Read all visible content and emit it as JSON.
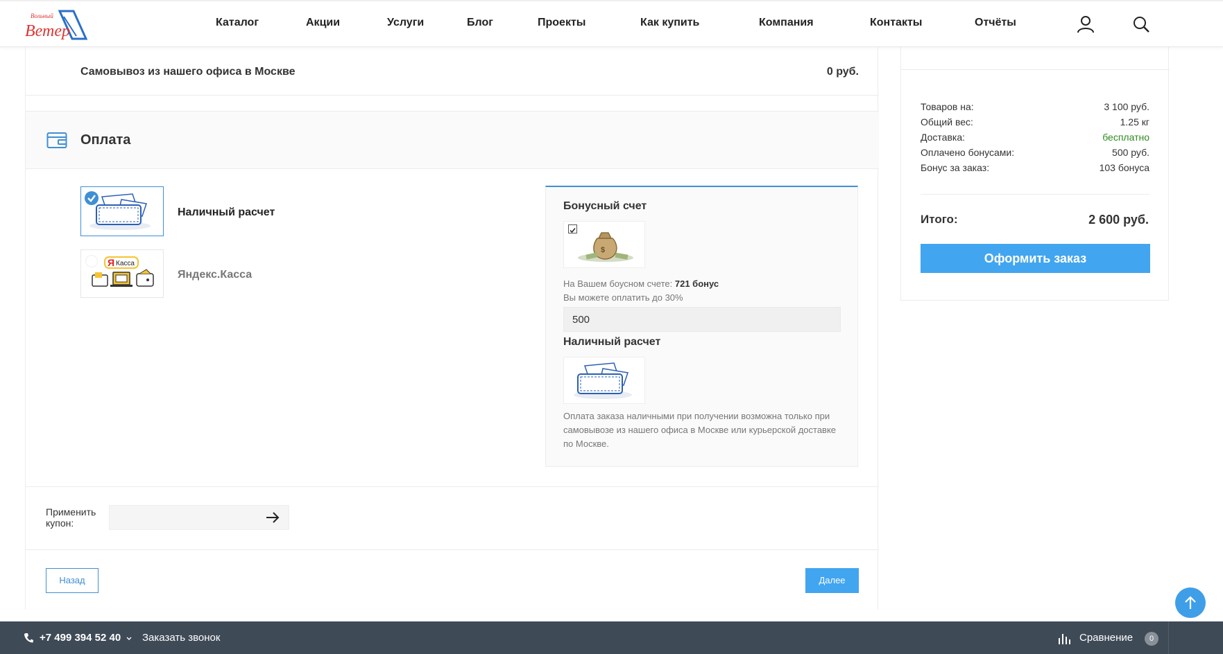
{
  "header": {
    "nav": [
      "Каталог",
      "Акции",
      "Услуги",
      "Блог",
      "Проекты",
      "Как купить",
      "Компания",
      "Контакты",
      "Отчёты"
    ],
    "icons": [
      "user-icon",
      "search-icon"
    ],
    "logo_text": [
      "Вольный",
      "Ветер"
    ]
  },
  "delivery": {
    "pickup_label": "Самовывоз из нашего офиса в Москве",
    "pickup_price": "0 руб."
  },
  "payment": {
    "title": "Оплата",
    "methods": [
      {
        "label": "Наличный расчет",
        "selected": true
      },
      {
        "label": "Яндекс.Касса",
        "selected": false,
        "logo_text": "Касса"
      }
    ]
  },
  "info": {
    "bonus_title": "Бонусный счет",
    "bonus_line1_prefix": "На Вашем боусном счете: ",
    "bonus_line1_value": "721 бонус",
    "bonus_line2": "Вы можете оплатить до 30%",
    "bonus_input_value": "500",
    "cash_title": "Наличный расчет",
    "cash_description": "Оплата заказа наличными при получении возможна только при самовывозе из нашего офиса в Москве или курьерской доставке по Москве."
  },
  "coupon": {
    "label": "Применить купон:"
  },
  "buttons": {
    "back": "Назад",
    "next": "Далее",
    "order": "Оформить заказ"
  },
  "summary": {
    "rows": [
      {
        "label": "Товаров на:",
        "value": "3 100 руб."
      },
      {
        "label": "Общий вес:",
        "value": "1.25 кг"
      },
      {
        "label": "Доставка:",
        "value": "бесплатно"
      },
      {
        "label": "Оплачено бонусами:",
        "value": "500 руб."
      },
      {
        "label": "Бонус за заказ:",
        "value": "103 бонуса"
      }
    ],
    "total_label": "Итого:",
    "total_value": "2 600 руб."
  },
  "footer": {
    "phone": "+7 499 394 52 40",
    "call": "Заказать звонок",
    "compare": "Сравнение",
    "compare_count": "0"
  },
  "colors": {
    "accent": "#42a5f0",
    "accent_dark": "#3f8fd4",
    "footer_bg": "#3f4a57",
    "free_delivery": "#2e8b1e"
  }
}
